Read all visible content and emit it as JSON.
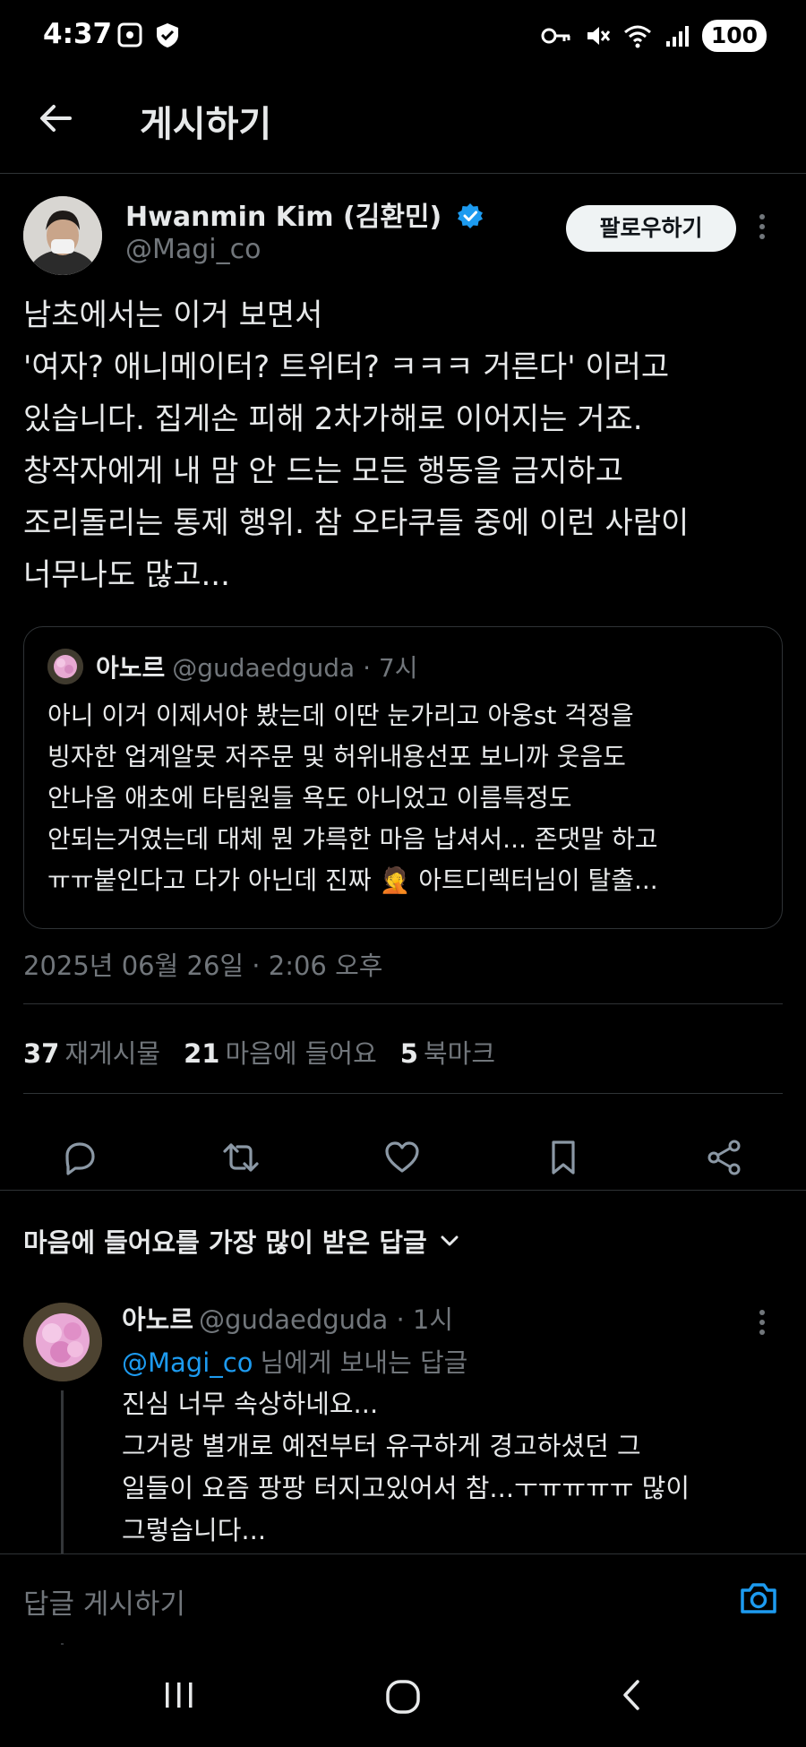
{
  "status_bar": {
    "time": "4:37",
    "battery": "100"
  },
  "header": {
    "title": "게시하기"
  },
  "post": {
    "author_name": "Hwanmin Kim (김환민)",
    "handle": "@Magi_co",
    "follow_label": "팔로우하기",
    "text": "남초에서는 이거 보면서\n'여자? 애니메이터? 트위터? ㅋㅋㅋ 거른다' 이러고\n있습니다. 집게손 피해 2차가해로 이어지는 거죠.\n창작자에게 내 맘 안 드는 모든 행동을 금지하고\n조리돌리는 통제 행위. 참 오타쿠들 중에 이런 사람이\n너무나도 많고...",
    "timestamp": "2025년 06월 26일 · 2:06 오후",
    "stats": {
      "reposts_count": "37",
      "reposts_label": "재게시물",
      "likes_count": "21",
      "likes_label": "마음에 들어요",
      "bookmarks_count": "5",
      "bookmarks_label": "북마크"
    }
  },
  "quote": {
    "name": "아노르",
    "handle": "@gudaedguda · 7시",
    "text_before_emoji": "아니 이거 이제서야 봤는데 이딴 눈가리고 아웅st 걱정을\n빙자한 업계알못 저주문 및 허위내용선포 보니까 웃음도\n안나옴 애초에 타팀원들 욕도 아니었고 이름특정도\n안되는거였는데 대체 뭔 갸륵한 마음 납셔서... 존댓말 하고\nㅠㅠ붙인다고 다가 아닌데 진짜 ",
    "emoji": "🤦",
    "text_after_emoji": " 아트디렉터님이 탈출..."
  },
  "sort": {
    "label": "마음에 들어요를 가장 많이 받은 답글"
  },
  "reply": {
    "name": "아노르",
    "handle": "@gudaedguda · 1시",
    "mention": "@Magi_co",
    "reply_to_suffix": "님에게 보내는 답글",
    "text": "진심 너무 속상하네요...\n그거랑 별개로 예전부터 유구하게 경고하셨던 그\n일들이 요즘 팡팡 터지고있어서 참...ㅜㅠㅠㅠㅠ 많이\n그렇습니다..."
  },
  "composer": {
    "placeholder": "답글 게시하기"
  },
  "colors": {
    "accent": "#1d9bf0",
    "muted": "#71767b",
    "text": "#e7e9ea",
    "border": "#2f3336"
  },
  "icons": [
    "back-arrow-icon",
    "verified-badge-icon",
    "more-icon",
    "reply-icon",
    "repost-icon",
    "like-icon",
    "bookmark-icon",
    "share-icon",
    "chevron-down-icon",
    "camera-icon",
    "recents-icon",
    "home-icon",
    "back-icon"
  ]
}
